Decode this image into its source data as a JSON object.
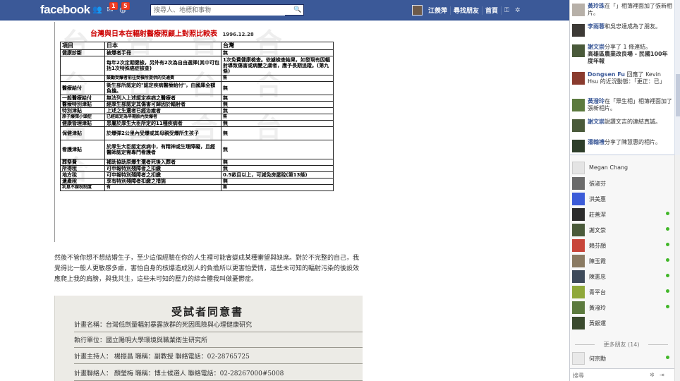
{
  "topbar": {
    "logo": "facebook",
    "badges": {
      "messages": "1",
      "notifications": "5"
    },
    "search_placeholder": "搜尋人、地標和事物",
    "user_name": "江羨萍",
    "find_friends": "尋找朋友",
    "home": "首頁"
  },
  "document": {
    "title": "台灣與日本在輻射醫療照顧上對照比較表",
    "date": "1996.12.28",
    "headers": [
      "項目",
      "日本",
      "台灣"
    ],
    "rows": [
      [
        "健康診斷",
        "被爆者手冊",
        "無"
      ],
      [
        "",
        "每年2次定期健檢，另外有2次為自由選擇(其中可包括1次特殊癌症檢查)",
        "1次免費健康檢查。依據檢查結果，如發現有因輻射導致傷害或病變之虞者，應予長期追蹤。(第九條)"
      ],
      [
        "",
        "鼓勵受爆者前往受檢所提供的交通費",
        "無"
      ],
      [
        "醫療給付",
        "衛生部所認定的\"認定疾病醫療給付\"，由國庫全額負擔。",
        "無"
      ],
      [
        "一般醫療給付",
        "無法列入上述認定疾病之醫療者",
        "無"
      ],
      [
        "醫療特別津貼",
        "經厚生部認定其傷害可歸因於輻射者",
        "無"
      ],
      [
        "特別津貼",
        "上述之生還者已經治癒者",
        "無"
      ],
      [
        "原子爆彈小頭症",
        "已經認定為早期胎內受爆者",
        "無"
      ],
      [
        "健康管理津貼",
        "患屬於厚生大臣所定的11種疾病者",
        "無"
      ],
      [
        "保健津貼",
        "於爆彈2公里內受爆或其母親受爆所生孩子",
        "無"
      ],
      [
        "看護津貼",
        "於厚生大臣認定疾病中，有精神或生理障礙，且經醫師認定需專門看護者",
        "無"
      ],
      [
        "葬祭費",
        "補助協助原爆生還者死後入葬者",
        "無"
      ],
      [
        "所得稅",
        "可申報特別殘障者之扣繳",
        "無"
      ],
      [
        "地方稅",
        "可申報特別殘障者之扣繳",
        "0.5畝目以上，可減免房屋稅(第13條)"
      ],
      [
        "遺產稅",
        "享有特別殘障者扣繳之措施",
        "無"
      ],
      [
        "利息不課稅制度",
        "有",
        "無"
      ]
    ]
  },
  "paragraph": "然後不管你想不想結婚生子，至少這個經驗在你的人生裡可能會變成某種審望與缺席。對於不完整的自己，我覺得比一般人更敏感多慮，害怕自身的核爆造成別人的負擔所以更害怕愛情，這些未可知的輻射污染的後設效應爬上我的肩膀，與我共生，這些未可知的壓力的綜合體我叫做憂鬱症。",
  "consent_form": {
    "title": "受試者同意書",
    "rows": [
      "計畫名稱：台灣低劑量輻射暴露族群的死因風險與心理健康研究",
      "執行單位：國立陽明大學環境與職業衛生研究所",
      "計畫主持人： 楊振昌          職稱：副教授     聯絡電話：02-28765725",
      "計畫聯絡人： 顏瑩梅          職稱：博士候選人  聯絡電話：02-28267000#5008"
    ]
  },
  "ticker": [
    {
      "name": "黃玲珠",
      "text": "在「」相簿裡面加了張新相片。"
    },
    {
      "name": "李雨蓉",
      "text": "和吳忠達成為了朋友。"
    },
    {
      "name": "謝文崇",
      "text": "分享了 1 條連結。",
      "link": "高雄區農業改良場 - 民國100年度年報"
    },
    {
      "name": "Dongsen Fu",
      "text": "回應了 Kevin Hsu 的近況動態：「更正：已」"
    },
    {
      "name": "黃潑玲",
      "text": "在「眾生相」相簿裡面加了張新相片。"
    },
    {
      "name": "謝文崇",
      "text": "說讚文吉的連結真誠。"
    },
    {
      "name": "潘翰禮",
      "text": "分享了陳慧惠的相片。"
    }
  ],
  "chat": {
    "friends": [
      {
        "name": "Megan Chang",
        "online": false
      },
      {
        "name": "張淑芬",
        "online": false
      },
      {
        "name": "洪美惠",
        "online": false
      },
      {
        "name": "莊善潔",
        "online": true
      },
      {
        "name": "謝文崇",
        "online": true
      },
      {
        "name": "賴芬顏",
        "online": true
      },
      {
        "name": "陳玉霞",
        "online": true
      },
      {
        "name": "陳憲忠",
        "online": true
      },
      {
        "name": "青平台",
        "online": true
      },
      {
        "name": "黃潑玲",
        "online": true
      },
      {
        "name": "黃銀運",
        "online": false
      }
    ],
    "more_label": "更多朋友 (14)",
    "more_friends": [
      {
        "name": "何宗勳",
        "online": true
      }
    ],
    "search_placeholder": "搜尋"
  },
  "colors": {
    "brand": "#3b5998",
    "online": "#42b72a",
    "badge": "#f03d25"
  }
}
